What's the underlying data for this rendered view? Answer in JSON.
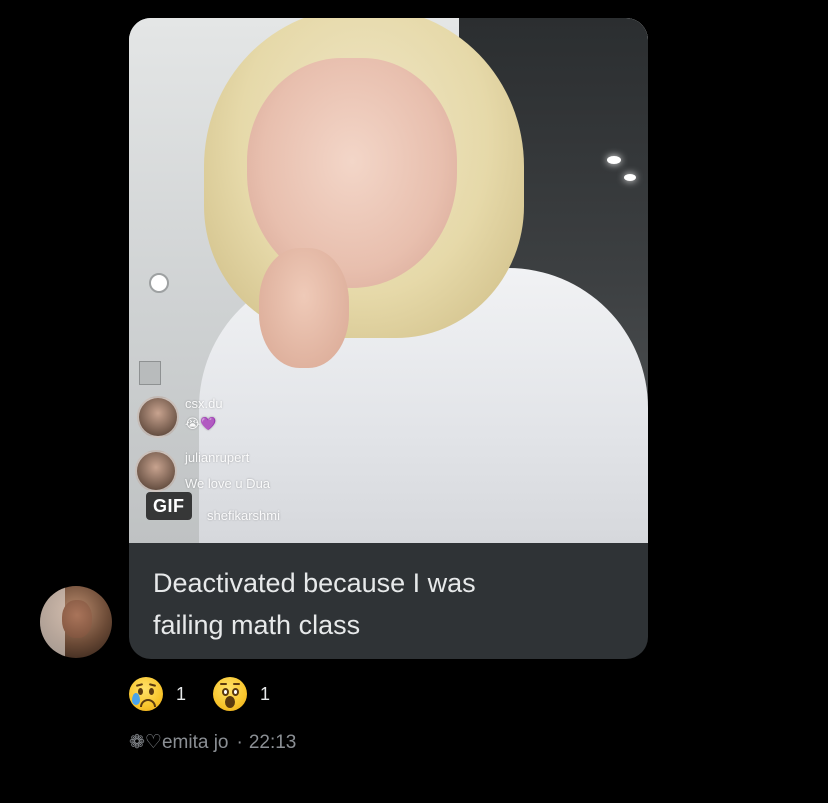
{
  "message": {
    "media": {
      "badge": "GIF",
      "live_comments": [
        {
          "user": "csx.du",
          "text": "😭💜"
        },
        {
          "user": "julianrupert",
          "text": "We love u Dua"
        },
        {
          "user": "shefikarshmi",
          "text": ""
        }
      ]
    },
    "caption_line1": "Deactivated because I was",
    "caption_line2": "failing math class"
  },
  "reactions": [
    {
      "icon": "crying-face-emoji",
      "count": "1"
    },
    {
      "icon": "astonished-face-emoji",
      "count": "1"
    }
  ],
  "meta": {
    "sender": "❁♡emita jo",
    "separator": "·",
    "time": "22:13"
  },
  "colors": {
    "background": "#000000",
    "bubble": "#2f3336",
    "text": "#e7e9ea",
    "muted": "#8b8f94"
  }
}
